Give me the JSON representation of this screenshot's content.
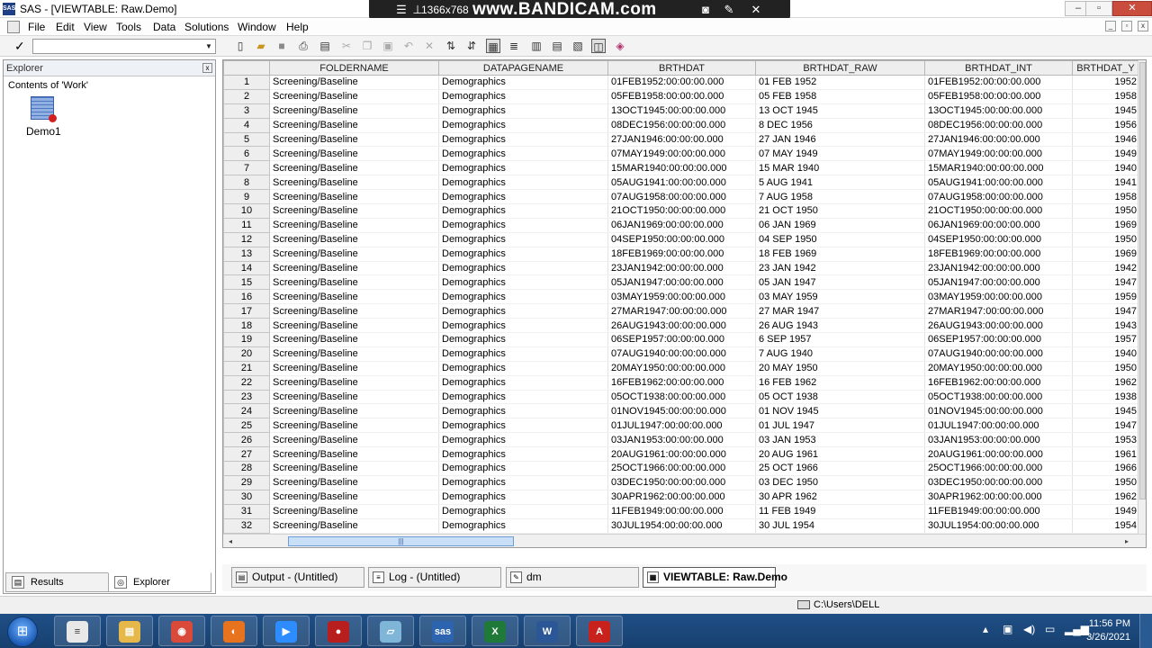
{
  "window": {
    "app_icon_text": "SAS",
    "title": "SAS - [VIEWTABLE: Raw.Demo]",
    "minimize": "–",
    "restore": "▫",
    "close": "✕"
  },
  "recorder": {
    "resolution": "1366x768",
    "watermark": "www.BANDICAM.com"
  },
  "menu": [
    "File",
    "Edit",
    "View",
    "Tools",
    "Data",
    "Solutions",
    "Window",
    "Help"
  ],
  "toolbar": {
    "check": "✓",
    "command_value": "",
    "dropdown": "▼"
  },
  "explorer": {
    "title": "Explorer",
    "close": "x",
    "contents_label": "Contents of 'Work'",
    "datasets": [
      "Demo1"
    ],
    "tabs": [
      "Results",
      "Explorer"
    ]
  },
  "viewtable": {
    "columns": [
      "FOLDERNAME",
      "DATAPAGENAME",
      "BRTHDAT",
      "BRTHDAT_RAW",
      "BRTHDAT_INT",
      "BRTHDAT_Y"
    ],
    "rows": [
      [
        "1",
        "Screening/Baseline",
        "Demographics",
        "01FEB1952:00:00:00.000",
        "01 FEB 1952",
        "01FEB1952:00:00:00.000",
        "1952"
      ],
      [
        "2",
        "Screening/Baseline",
        "Demographics",
        "05FEB1958:00:00:00.000",
        "05 FEB 1958",
        "05FEB1958:00:00:00.000",
        "1958"
      ],
      [
        "3",
        "Screening/Baseline",
        "Demographics",
        "13OCT1945:00:00:00.000",
        "13 OCT 1945",
        "13OCT1945:00:00:00.000",
        "1945"
      ],
      [
        "4",
        "Screening/Baseline",
        "Demographics",
        "08DEC1956:00:00:00.000",
        "8 DEC 1956",
        "08DEC1956:00:00:00.000",
        "1956"
      ],
      [
        "5",
        "Screening/Baseline",
        "Demographics",
        "27JAN1946:00:00:00.000",
        "27 JAN 1946",
        "27JAN1946:00:00:00.000",
        "1946"
      ],
      [
        "6",
        "Screening/Baseline",
        "Demographics",
        "07MAY1949:00:00:00.000",
        "07 MAY 1949",
        "07MAY1949:00:00:00.000",
        "1949"
      ],
      [
        "7",
        "Screening/Baseline",
        "Demographics",
        "15MAR1940:00:00:00.000",
        "15 MAR 1940",
        "15MAR1940:00:00:00.000",
        "1940"
      ],
      [
        "8",
        "Screening/Baseline",
        "Demographics",
        "05AUG1941:00:00:00.000",
        "5 AUG 1941",
        "05AUG1941:00:00:00.000",
        "1941"
      ],
      [
        "9",
        "Screening/Baseline",
        "Demographics",
        "07AUG1958:00:00:00.000",
        "7 AUG 1958",
        "07AUG1958:00:00:00.000",
        "1958"
      ],
      [
        "10",
        "Screening/Baseline",
        "Demographics",
        "21OCT1950:00:00:00.000",
        "21 OCT 1950",
        "21OCT1950:00:00:00.000",
        "1950"
      ],
      [
        "11",
        "Screening/Baseline",
        "Demographics",
        "06JAN1969:00:00:00.000",
        "06 JAN 1969",
        "06JAN1969:00:00:00.000",
        "1969"
      ],
      [
        "12",
        "Screening/Baseline",
        "Demographics",
        "04SEP1950:00:00:00.000",
        "04 SEP 1950",
        "04SEP1950:00:00:00.000",
        "1950"
      ],
      [
        "13",
        "Screening/Baseline",
        "Demographics",
        "18FEB1969:00:00:00.000",
        "18 FEB 1969",
        "18FEB1969:00:00:00.000",
        "1969"
      ],
      [
        "14",
        "Screening/Baseline",
        "Demographics",
        "23JAN1942:00:00:00.000",
        "23 JAN 1942",
        "23JAN1942:00:00:00.000",
        "1942"
      ],
      [
        "15",
        "Screening/Baseline",
        "Demographics",
        "05JAN1947:00:00:00.000",
        "05 JAN 1947",
        "05JAN1947:00:00:00.000",
        "1947"
      ],
      [
        "16",
        "Screening/Baseline",
        "Demographics",
        "03MAY1959:00:00:00.000",
        "03 MAY 1959",
        "03MAY1959:00:00:00.000",
        "1959"
      ],
      [
        "17",
        "Screening/Baseline",
        "Demographics",
        "27MAR1947:00:00:00.000",
        "27 MAR 1947",
        "27MAR1947:00:00:00.000",
        "1947"
      ],
      [
        "18",
        "Screening/Baseline",
        "Demographics",
        "26AUG1943:00:00:00.000",
        "26 AUG 1943",
        "26AUG1943:00:00:00.000",
        "1943"
      ],
      [
        "19",
        "Screening/Baseline",
        "Demographics",
        "06SEP1957:00:00:00.000",
        "6 SEP 1957",
        "06SEP1957:00:00:00.000",
        "1957"
      ],
      [
        "20",
        "Screening/Baseline",
        "Demographics",
        "07AUG1940:00:00:00.000",
        "7 AUG 1940",
        "07AUG1940:00:00:00.000",
        "1940"
      ],
      [
        "21",
        "Screening/Baseline",
        "Demographics",
        "20MAY1950:00:00:00.000",
        "20 MAY 1950",
        "20MAY1950:00:00:00.000",
        "1950"
      ],
      [
        "22",
        "Screening/Baseline",
        "Demographics",
        "16FEB1962:00:00:00.000",
        "16 FEB 1962",
        "16FEB1962:00:00:00.000",
        "1962"
      ],
      [
        "23",
        "Screening/Baseline",
        "Demographics",
        "05OCT1938:00:00:00.000",
        "05 OCT 1938",
        "05OCT1938:00:00:00.000",
        "1938"
      ],
      [
        "24",
        "Screening/Baseline",
        "Demographics",
        "01NOV1945:00:00:00.000",
        "01 NOV 1945",
        "01NOV1945:00:00:00.000",
        "1945"
      ],
      [
        "25",
        "Screening/Baseline",
        "Demographics",
        "01JUL1947:00:00:00.000",
        "01 JUL 1947",
        "01JUL1947:00:00:00.000",
        "1947"
      ],
      [
        "26",
        "Screening/Baseline",
        "Demographics",
        "03JAN1953:00:00:00.000",
        "03 JAN 1953",
        "03JAN1953:00:00:00.000",
        "1953"
      ],
      [
        "27",
        "Screening/Baseline",
        "Demographics",
        "20AUG1961:00:00:00.000",
        "20 AUG 1961",
        "20AUG1961:00:00:00.000",
        "1961"
      ],
      [
        "28",
        "Screening/Baseline",
        "Demographics",
        "25OCT1966:00:00:00.000",
        "25 OCT 1966",
        "25OCT1966:00:00:00.000",
        "1966"
      ],
      [
        "29",
        "Screening/Baseline",
        "Demographics",
        "03DEC1950:00:00:00.000",
        "03 DEC 1950",
        "03DEC1950:00:00:00.000",
        "1950"
      ],
      [
        "30",
        "Screening/Baseline",
        "Demographics",
        "30APR1962:00:00:00.000",
        "30 APR 1962",
        "30APR1962:00:00:00.000",
        "1962"
      ],
      [
        "31",
        "Screening/Baseline",
        "Demographics",
        "11FEB1949:00:00:00.000",
        "11 FEB 1949",
        "11FEB1949:00:00:00.000",
        "1949"
      ],
      [
        "32",
        "Screening/Baseline",
        "Demographics",
        "30JUL1954:00:00:00.000",
        "30 JUL 1954",
        "30JUL1954:00:00:00.000",
        "1954"
      ]
    ]
  },
  "window_tabs": [
    {
      "label": "Output - (Untitled)",
      "active": false
    },
    {
      "label": "Log - (Untitled)",
      "active": false
    },
    {
      "label": "dm",
      "active": false
    },
    {
      "label": "VIEWTABLE: Raw.Demo",
      "active": true
    }
  ],
  "statusbar": {
    "path": "C:\\Users\\DELL"
  },
  "taskbar": {
    "start_glyph": "⊞",
    "apps": [
      {
        "name": "notepad",
        "label": "≡",
        "color": "#e8e8e8"
      },
      {
        "name": "file-explorer",
        "label": "▤",
        "color": "#e6b84a"
      },
      {
        "name": "chrome",
        "label": "◉",
        "color": "#d94a3a"
      },
      {
        "name": "firefox",
        "label": "◐",
        "color": "#e8731f"
      },
      {
        "name": "zoom",
        "label": "▶",
        "color": "#2d8cff"
      },
      {
        "name": "recorder",
        "label": "●",
        "color": "#b81e1e"
      },
      {
        "name": "sticky",
        "label": "▱",
        "color": "#7fb6d8"
      },
      {
        "name": "sas",
        "label": "sas",
        "color": "#2c64b0"
      },
      {
        "name": "excel",
        "label": "X",
        "color": "#1f7a3a"
      },
      {
        "name": "word",
        "label": "W",
        "color": "#2b5797"
      },
      {
        "name": "acrobat",
        "label": "A",
        "color": "#c9221c"
      }
    ],
    "time": "11:56 PM",
    "date": "3/26/2021"
  }
}
